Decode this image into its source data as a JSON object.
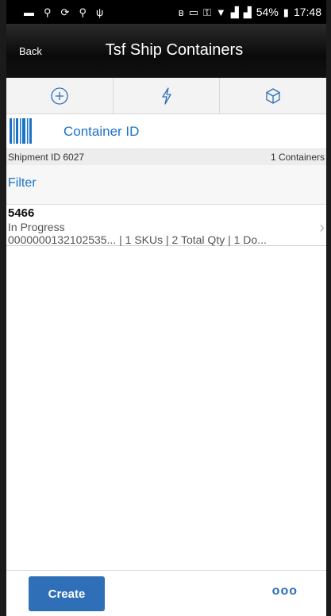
{
  "status_bar": {
    "battery": "54%",
    "time": "17:48",
    "icons": [
      "message-icon",
      "location-icon",
      "sync-icon",
      "location-icon",
      "usb-icon",
      "bluetooth-icon",
      "volte-icon",
      "key-icon",
      "wifi-icon",
      "signal-icon",
      "signal-icon",
      "battery-icon"
    ]
  },
  "header": {
    "back_label": "Back",
    "title": "Tsf Ship Containers"
  },
  "actions": [
    {
      "icon": "add-icon"
    },
    {
      "icon": "lightning-icon"
    },
    {
      "icon": "box-icon"
    }
  ],
  "scan": {
    "icon": "barcode-icon",
    "label": "Container ID"
  },
  "info": {
    "shipment": "Shipment ID 6027",
    "count": "1 Containers"
  },
  "filter": {
    "label": "Filter"
  },
  "containers": [
    {
      "id": "5466",
      "status": "In Progress",
      "detail": "0000000132102535...   | 1 SKUs | 2 Total Qty | 1 Do..."
    }
  ],
  "footer": {
    "create_label": "Create",
    "more_label": "ooo"
  },
  "colors": {
    "accent": "#1a73c7",
    "button": "#2f6fb8",
    "header": "#000000"
  }
}
